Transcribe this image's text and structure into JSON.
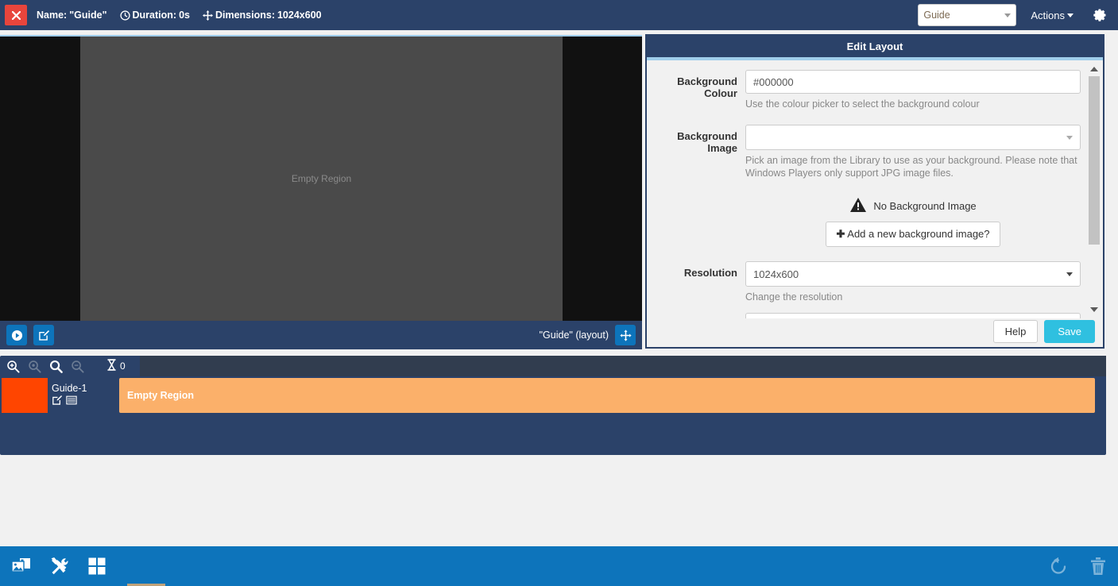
{
  "topbar": {
    "close_icon": "close-icon",
    "name_label": "Name:",
    "name_value": "\"Guide\"",
    "duration_icon": "clock-icon",
    "duration_label": "Duration:",
    "duration_value": "0s",
    "dimensions_icon": "arrows-icon",
    "dimensions_label": "Dimensions:",
    "dimensions_value": "1024x600",
    "layout_select_value": "Guide",
    "actions_label": "Actions",
    "gear_icon": "gear-icon"
  },
  "canvas": {
    "region_label": "Empty Region",
    "background_colour": "#000000",
    "letterbox_colour": "#111111",
    "region_colour": "#4a4a4a"
  },
  "preview_toolbar": {
    "play_icon": "play-icon",
    "edit_icon": "edit-icon",
    "layout_name": "\"Guide\" (layout)",
    "move_icon": "move-icon"
  },
  "panel": {
    "title": "Edit Layout",
    "background_colour": {
      "label": "Background Colour",
      "value": "#000000",
      "help": "Use the colour picker to select the background colour"
    },
    "background_image": {
      "label": "Background Image",
      "value": "",
      "help": "Pick an image from the Library to use as your background. Please note that Windows Players only support JPG image files.",
      "warning_icon": "warning-triangle-icon",
      "warning_text": "No Background Image",
      "add_button": "Add a new background image?",
      "add_icon": "plus-icon"
    },
    "resolution": {
      "label": "Resolution",
      "value": "1024x600",
      "help": "Change the resolution"
    },
    "footer": {
      "help_label": "Help",
      "save_label": "Save"
    },
    "accent_colour": "#9fcdeb",
    "header_colour": "#2b4269"
  },
  "timeline": {
    "zoom_in_icon": "zoom-in-icon",
    "zoom_fit_icon": "zoom-fit-icon",
    "zoom_search_icon": "zoom-search-icon",
    "zoom_out_icon": "zoom-out-icon",
    "hourglass_icon": "hourglass-icon",
    "hourglass_value": "0",
    "region": {
      "swatch_colour": "#ff4500",
      "name": "Guide-1",
      "edit_icon": "edit-icon",
      "list_icon": "list-icon",
      "bar_label": "Empty Region",
      "bar_colour": "#fbb06a"
    }
  },
  "bottombar": {
    "library_icon": "library-images-icon",
    "tools_icon": "tools-icon",
    "widgets_icon": "widgets-grid-icon",
    "undo_icon": "undo-icon",
    "delete_icon": "trash-icon",
    "bar_colour": "#0d74bb"
  }
}
